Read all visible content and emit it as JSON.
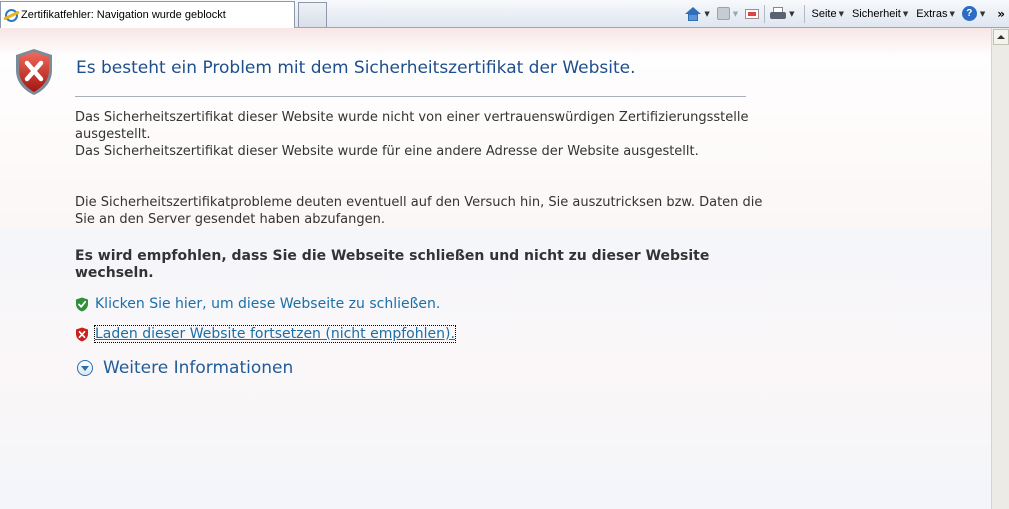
{
  "tab": {
    "title": "Zertifikatfehler: Navigation wurde geblockt",
    "icon": "ie-page-icon"
  },
  "commandbar": {
    "items": [
      {
        "label": "Seite",
        "icon": "page-icon"
      },
      {
        "label": "Sicherheit",
        "icon": "security-icon"
      },
      {
        "label": "Extras",
        "icon": "tools-icon"
      }
    ],
    "help_label": "?",
    "overflow_label": "»",
    "icons": [
      "home-icon",
      "feed-icon",
      "mail-icon",
      "print-icon",
      "help-icon"
    ]
  },
  "page": {
    "heading": "Es besteht ein Problem mit dem Sicherheitszertifikat der Website.",
    "paragraph1": "Das Sicherheitszertifikat dieser Website wurde nicht von einer vertrauenswürdigen Zertifizierungsstelle ausgestellt.",
    "paragraph2": "Das Sicherheitszertifikat dieser Website wurde für eine andere Adresse der Website ausgestellt.",
    "paragraph3": "Die Sicherheitszertifikatprobleme deuten eventuell auf den Versuch hin, Sie auszutricksen bzw. Daten die Sie an den Server gesendet haben abzufangen.",
    "recommendation": "Es wird empfohlen, dass Sie die Webseite schließen und nicht zu dieser Website wechseln.",
    "close_link": "Klicken Sie hier, um diese Webseite zu schließen.",
    "continue_link": "Laden dieser Website fortsetzen (nicht empfohlen).",
    "more_info": "Weitere Informationen"
  },
  "colors": {
    "heading": "#1f4e8c",
    "link": "#1a6fa8",
    "error_red": "#c9211e",
    "safe_green": "#2f8f3a"
  }
}
